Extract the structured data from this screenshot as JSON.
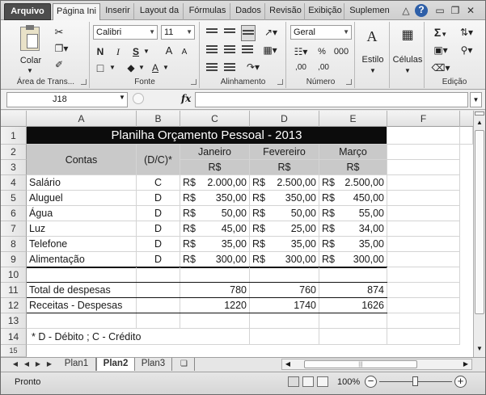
{
  "ribbon_tabs": [
    "Arquivo",
    "Página Ini",
    "Inserir",
    "Layout da",
    "Fórmulas",
    "Dados",
    "Revisão",
    "Exibição",
    "Suplemen"
  ],
  "clipboard": {
    "paste_label": "Colar",
    "group_label": "Área de Trans..."
  },
  "font": {
    "name": "Calibri",
    "size": "11",
    "bold": "N",
    "italic": "I",
    "underline": "S",
    "grow": "A",
    "shrink": "A",
    "color": "A",
    "group_label": "Fonte"
  },
  "alignment": {
    "group_label": "Alinhamento"
  },
  "number": {
    "format": "Geral",
    "percent": "%",
    "thousands": "000",
    "inc_decimal": ",00",
    "dec_decimal": ",00",
    "group_label": "Número"
  },
  "styles": {
    "label": "Estilo"
  },
  "cells_group": {
    "label": "Células"
  },
  "editing": {
    "sigma": "Σ",
    "group_label": "Edição"
  },
  "formula_bar": {
    "name_box": "J18",
    "fx": "fx",
    "formula": ""
  },
  "columns": [
    "A",
    "B",
    "C",
    "D",
    "E",
    "F"
  ],
  "rows": [
    "1",
    "2",
    "3",
    "4",
    "5",
    "6",
    "7",
    "8",
    "9",
    "10",
    "11",
    "12",
    "13",
    "14",
    "15"
  ],
  "sheet": {
    "title": "Planilha Orçamento Pessoal - 2013",
    "header_contas": "Contas",
    "header_dc": "(D/C)*",
    "months": [
      "Janeiro",
      "Fevereiro",
      "Março"
    ],
    "currency": "R$",
    "data_rows": [
      {
        "conta": "Salário",
        "dc": "C",
        "values": [
          "2.000,00",
          "2.500,00",
          "2.500,00"
        ]
      },
      {
        "conta": "Aluguel",
        "dc": "D",
        "values": [
          "350,00",
          "350,00",
          "450,00"
        ]
      },
      {
        "conta": "Água",
        "dc": "D",
        "values": [
          "50,00",
          "50,00",
          "55,00"
        ]
      },
      {
        "conta": "Luz",
        "dc": "D",
        "values": [
          "45,00",
          "25,00",
          "34,00"
        ]
      },
      {
        "conta": "Telefone",
        "dc": "D",
        "values": [
          "35,00",
          "35,00",
          "35,00"
        ]
      },
      {
        "conta": "Alimentação",
        "dc": "D",
        "values": [
          "300,00",
          "300,00",
          "300,00"
        ]
      }
    ],
    "total_label": "Total de despesas",
    "totals": [
      "780",
      "760",
      "874"
    ],
    "receitas_label": "Receitas - Despesas",
    "receitas": [
      "1220",
      "1740",
      "1626"
    ],
    "note": "* D - Débito ; C - Crédito"
  },
  "sheet_tabs": [
    "Plan1",
    "Plan2",
    "Plan3"
  ],
  "status": {
    "text": "Pronto",
    "zoom": "100%"
  }
}
